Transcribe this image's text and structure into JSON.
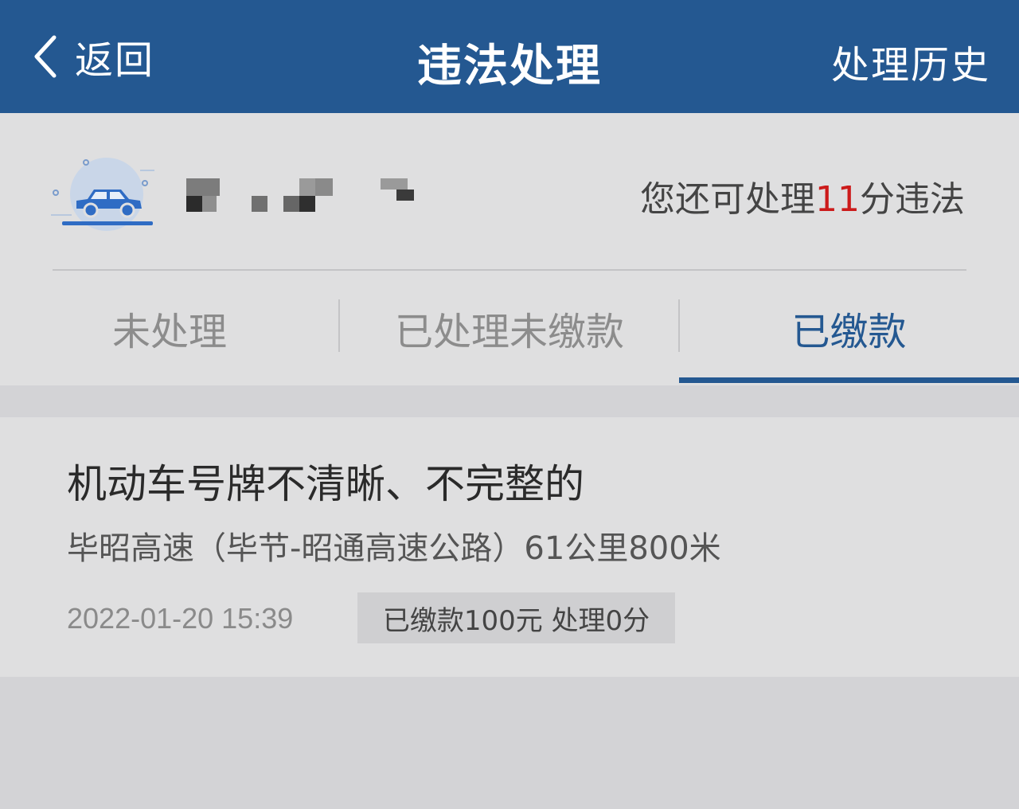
{
  "header": {
    "back_label": "返回",
    "title": "违法处理",
    "history_label": "处理历史"
  },
  "vehicle": {
    "icon": "car-icon",
    "points_prefix": "您还可处理",
    "points_value": "11",
    "points_suffix": "分违法"
  },
  "tabs": [
    {
      "label": "未处理",
      "active": false
    },
    {
      "label": "已处理未缴款",
      "active": false
    },
    {
      "label": "已缴款",
      "active": true
    }
  ],
  "records": [
    {
      "title": "机动车号牌不清晰、不完整的",
      "location": "毕昭高速（毕节-昭通高速公路）61公里800米",
      "time": "2022-01-20 15:39",
      "status": "已缴款100元 处理0分"
    }
  ],
  "colors": {
    "header_bg": "#245891",
    "accent": "#245891",
    "points_highlight": "#cc1b1b"
  }
}
